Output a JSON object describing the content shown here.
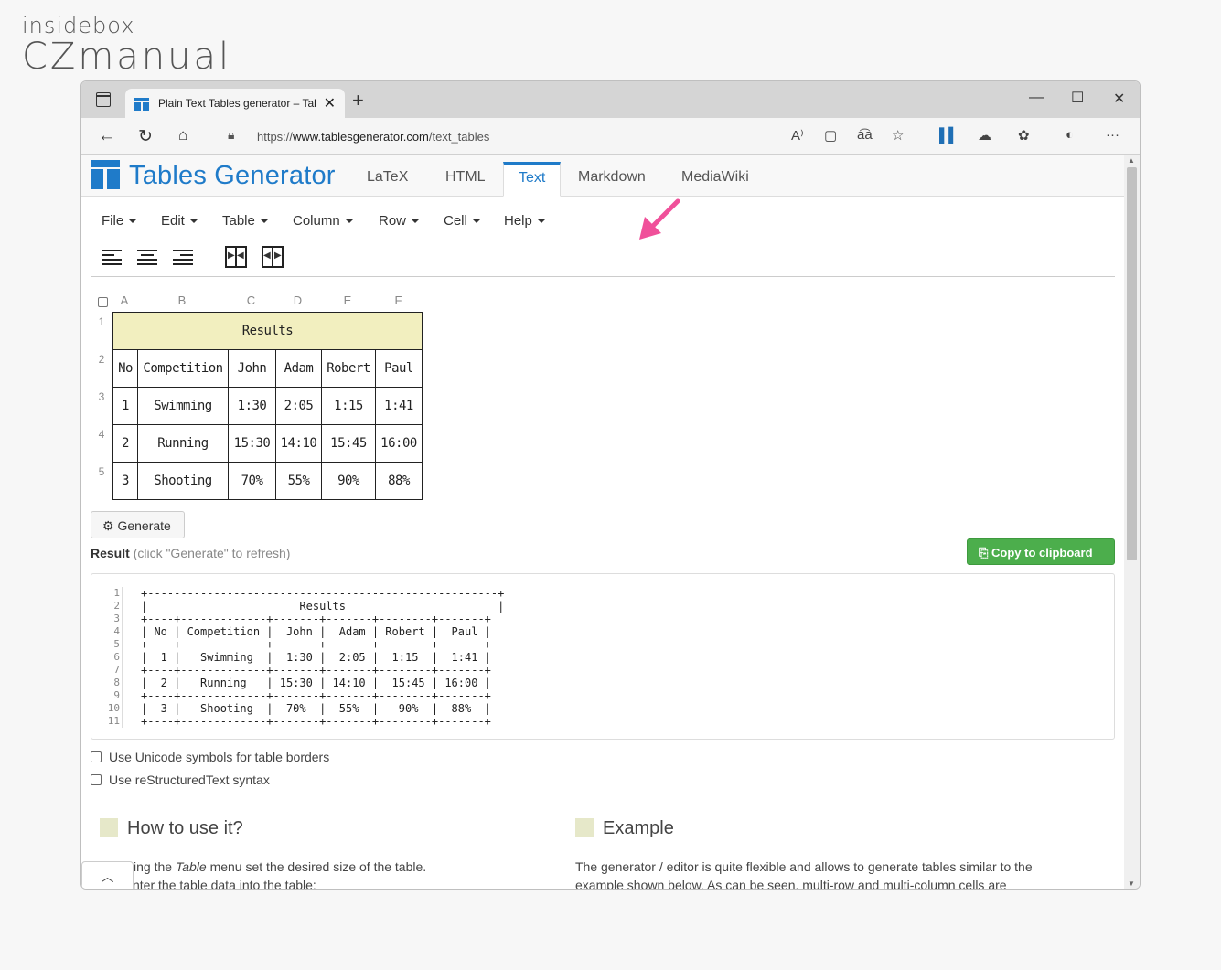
{
  "watermark": {
    "line1": "insidebox",
    "line2": "CZmanual"
  },
  "browser": {
    "tab_title": "Plain Text Tables generator – Tab",
    "new_tab": "+",
    "url_prefix": "https://",
    "url_domain": "www.tablesgenerator.com",
    "url_path": "/text_tables"
  },
  "site": {
    "brand": "Tables Generator",
    "nav_tabs": [
      "LaTeX",
      "HTML",
      "Text",
      "Markdown",
      "MediaWiki"
    ],
    "active_tab": "Text",
    "menus": [
      "File",
      "Edit",
      "Table",
      "Column",
      "Row",
      "Cell",
      "Help"
    ]
  },
  "grid": {
    "col_headers": [
      "A",
      "B",
      "C",
      "D",
      "E",
      "F"
    ],
    "row_headers": [
      "1",
      "2",
      "3",
      "4",
      "5"
    ],
    "title": "Results",
    "header_row": [
      "No",
      "Competition",
      "John",
      "Adam",
      "Robert",
      "Paul"
    ],
    "rows": [
      [
        "1",
        "Swimming",
        "1:30",
        "2:05",
        "1:15",
        "1:41"
      ],
      [
        "2",
        "Running",
        "15:30",
        "14:10",
        "15:45",
        "16:00"
      ],
      [
        "3",
        "Shooting",
        "70%",
        "55%",
        "90%",
        "88%"
      ]
    ]
  },
  "actions": {
    "generate": "Generate",
    "result_label": "Result",
    "result_hint": "(click \"Generate\" to refresh)",
    "copy": "Copy to clipboard"
  },
  "output": {
    "line_numbers": [
      "1",
      "2",
      "3",
      "4",
      "5",
      "6",
      "7",
      "8",
      "9",
      "10",
      "11"
    ],
    "text": "+-----------------------------------------------------+\n|                       Results                       |\n+----+-------------+-------+-------+--------+-------+\n| No | Competition |  John |  Adam | Robert |  Paul |\n+----+-------------+-------+-------+--------+-------+\n|  1 |   Swimming  |  1:30 |  2:05 |  1:15  |  1:41 |\n+----+-------------+-------+-------+--------+-------+\n|  2 |   Running   | 15:30 | 14:10 |  15:45 | 16:00 |\n+----+-------------+-------+-------+--------+-------+\n|  3 |   Shooting  |  70%  |  55%  |   90%  |  88%  |\n+----+-------------+-------+-------+--------+-------+"
  },
  "options": [
    "Use Unicode symbols for table borders",
    "Use reStructuredText syntax"
  ],
  "sections": {
    "howto_title": "How to use it?",
    "howto_line1_a": "sing the ",
    "howto_line1_em": "Table",
    "howto_line1_b": " menu set the desired size of the table.",
    "howto_line2": "nter the table data into the table:",
    "example_title": "Example",
    "example_line1": "The generator / editor is quite flexible and allows to generate tables similar to the",
    "example_line2": "example shown below. As can be seen, multi-row and multi-column cells are"
  },
  "colors": {
    "accent": "#1f7bc9",
    "copy_button": "#4cae4c",
    "highlight_cell": "#f2efbf",
    "arrow": "#f0509a"
  }
}
